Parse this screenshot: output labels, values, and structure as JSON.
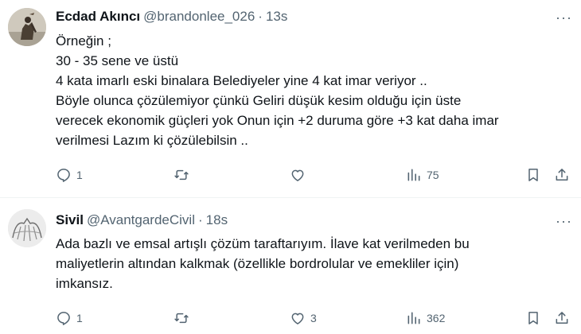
{
  "tweets": [
    {
      "name": "Ecdad Akıncı",
      "handle": "@brandonlee_026",
      "separator": "·",
      "time": "13s",
      "lines": [
        "Örneğin ;",
        "30 - 35 sene ve üstü",
        "4 kata imarlı eski binalara  Belediyeler yine 4 kat imar veriyor ..",
        "Böyle olunca çözülemiyor çünkü Geliri düşük kesim olduğu için üste",
        "verecek ekonomik güçleri yok Onun için +2 duruma göre +3 kat daha imar",
        "verilmesi Lazım ki çözülebilsin .."
      ],
      "replies": "1",
      "retweets": "",
      "likes": "",
      "views": "75"
    },
    {
      "name": "Sivil",
      "handle": "@AvantgardeCivil",
      "separator": "·",
      "time": "18s",
      "lines": [
        "Ada bazlı ve emsal artışlı çözüm taraftarıyım. İlave kat verilmeden bu",
        "maliyetlerin altından kalkmak (özellikle bordrolular ve emekliler için)",
        "imkansız."
      ],
      "replies": "1",
      "retweets": "",
      "likes": "3",
      "views": "362"
    }
  ],
  "icons": [
    "reply-icon",
    "retweet-icon",
    "like-icon",
    "views-icon",
    "bookmark-icon",
    "share-icon",
    "more-icon"
  ],
  "colors": {
    "text": "#0f1419",
    "secondary": "#536471",
    "divider": "#eff3f4"
  }
}
